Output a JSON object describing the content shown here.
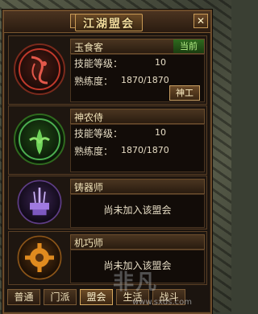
{
  "window": {
    "title": "江湖盟会",
    "help_label": "?",
    "close_label": "✕"
  },
  "guilds": [
    {
      "name": "玉食客",
      "status": "当前",
      "skill_label": "技能等级：",
      "skill_value": "10",
      "prof_label": "熟练度：",
      "prof_value": "1870/1870",
      "emblem_icon": "chef-emblem-icon",
      "accent": "#c0392b"
    },
    {
      "name": "神农侍",
      "skill_label": "技能等级：",
      "skill_value": "10",
      "prof_label": "熟练度：",
      "prof_value": "1870/1870",
      "action_label": "神工",
      "emblem_icon": "herbalist-emblem-icon",
      "accent": "#4caf50"
    },
    {
      "name": "铸器师",
      "not_joined": "尚未加入该盟会",
      "emblem_icon": "smith-emblem-icon",
      "accent": "#8e5ad6"
    },
    {
      "name": "机巧师",
      "not_joined": "尚未加入该盟会",
      "emblem_icon": "mechanist-emblem-icon",
      "accent": "#e08b1f"
    }
  ],
  "tabs": [
    {
      "label": "普通",
      "active": false
    },
    {
      "label": "门派",
      "active": false
    },
    {
      "label": "盟会",
      "active": true
    },
    {
      "label": "生活",
      "active": false
    },
    {
      "label": "战斗",
      "active": false
    }
  ],
  "watermark": {
    "text": "非凡",
    "url": "www.sxds.com"
  }
}
